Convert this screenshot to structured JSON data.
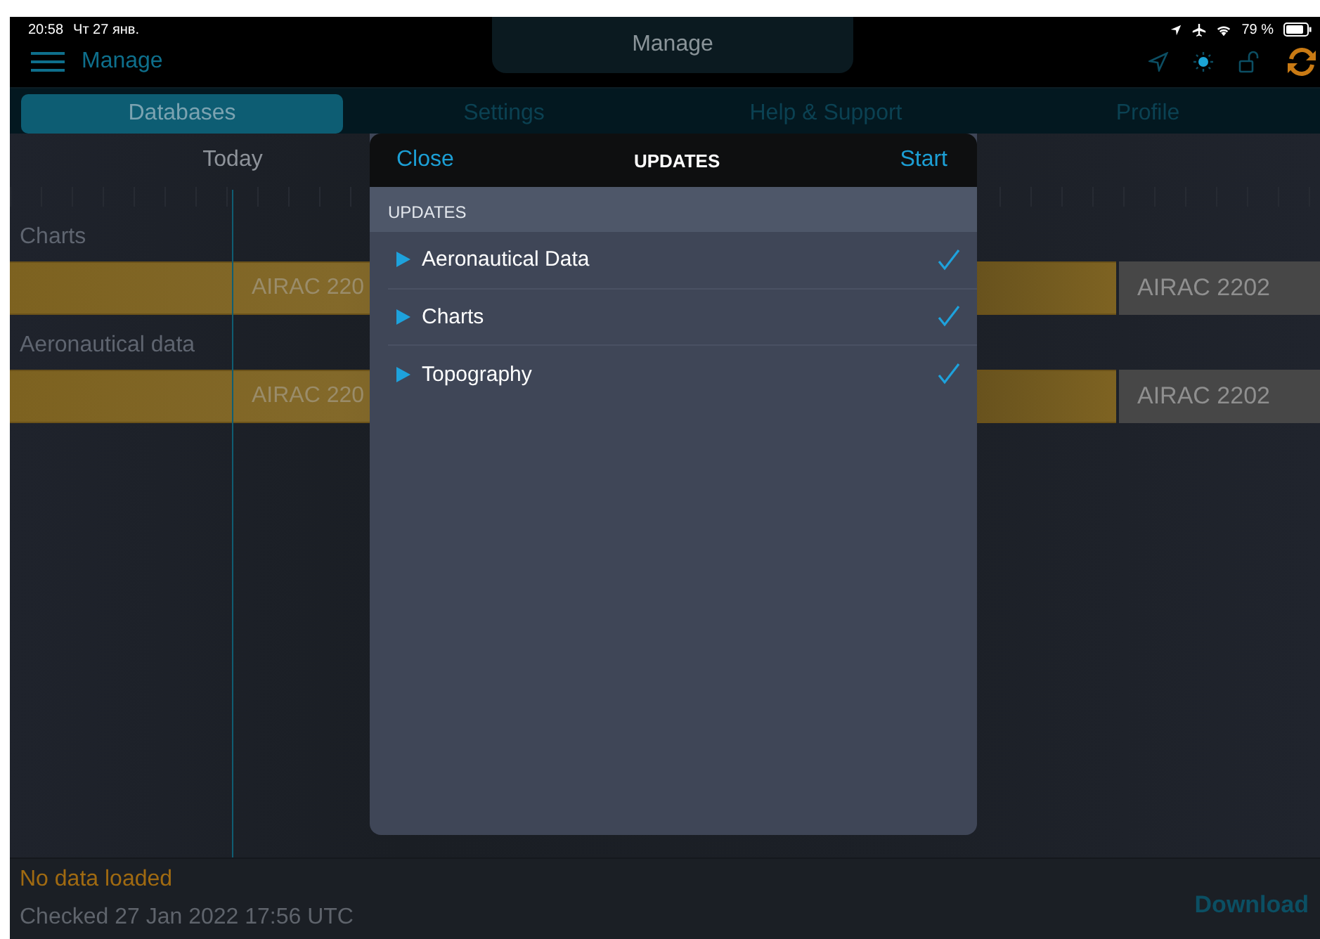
{
  "status_bar": {
    "time": "20:58",
    "date": "Чт 27 янв.",
    "battery": "79 %"
  },
  "header": {
    "menu_label": "Manage",
    "title": "Manage"
  },
  "tabs": [
    {
      "label": "Databases",
      "selected": true
    },
    {
      "label": "Settings",
      "selected": false
    },
    {
      "label": "Help & Support",
      "selected": false
    },
    {
      "label": "Profile",
      "selected": false
    }
  ],
  "timeline": {
    "today": "Today",
    "rows": [
      {
        "label": "Charts",
        "bar_text": "AIRAC 220",
        "end_text": "AIRAC 2202"
      },
      {
        "label": "Aeronautical data",
        "bar_text": "AIRAC 220",
        "end_text": "AIRAC 2202"
      }
    ]
  },
  "dialog": {
    "close": "Close",
    "title": "UPDATES",
    "start": "Start",
    "section": "UPDATES",
    "items": [
      {
        "label": "Aeronautical Data",
        "checked": true
      },
      {
        "label": "Charts",
        "checked": true
      },
      {
        "label": "Topography",
        "checked": true
      }
    ]
  },
  "footer": {
    "status": "No data loaded",
    "checked": "Checked 27 Jan 2022 17:56 UTC",
    "download": "Download"
  }
}
